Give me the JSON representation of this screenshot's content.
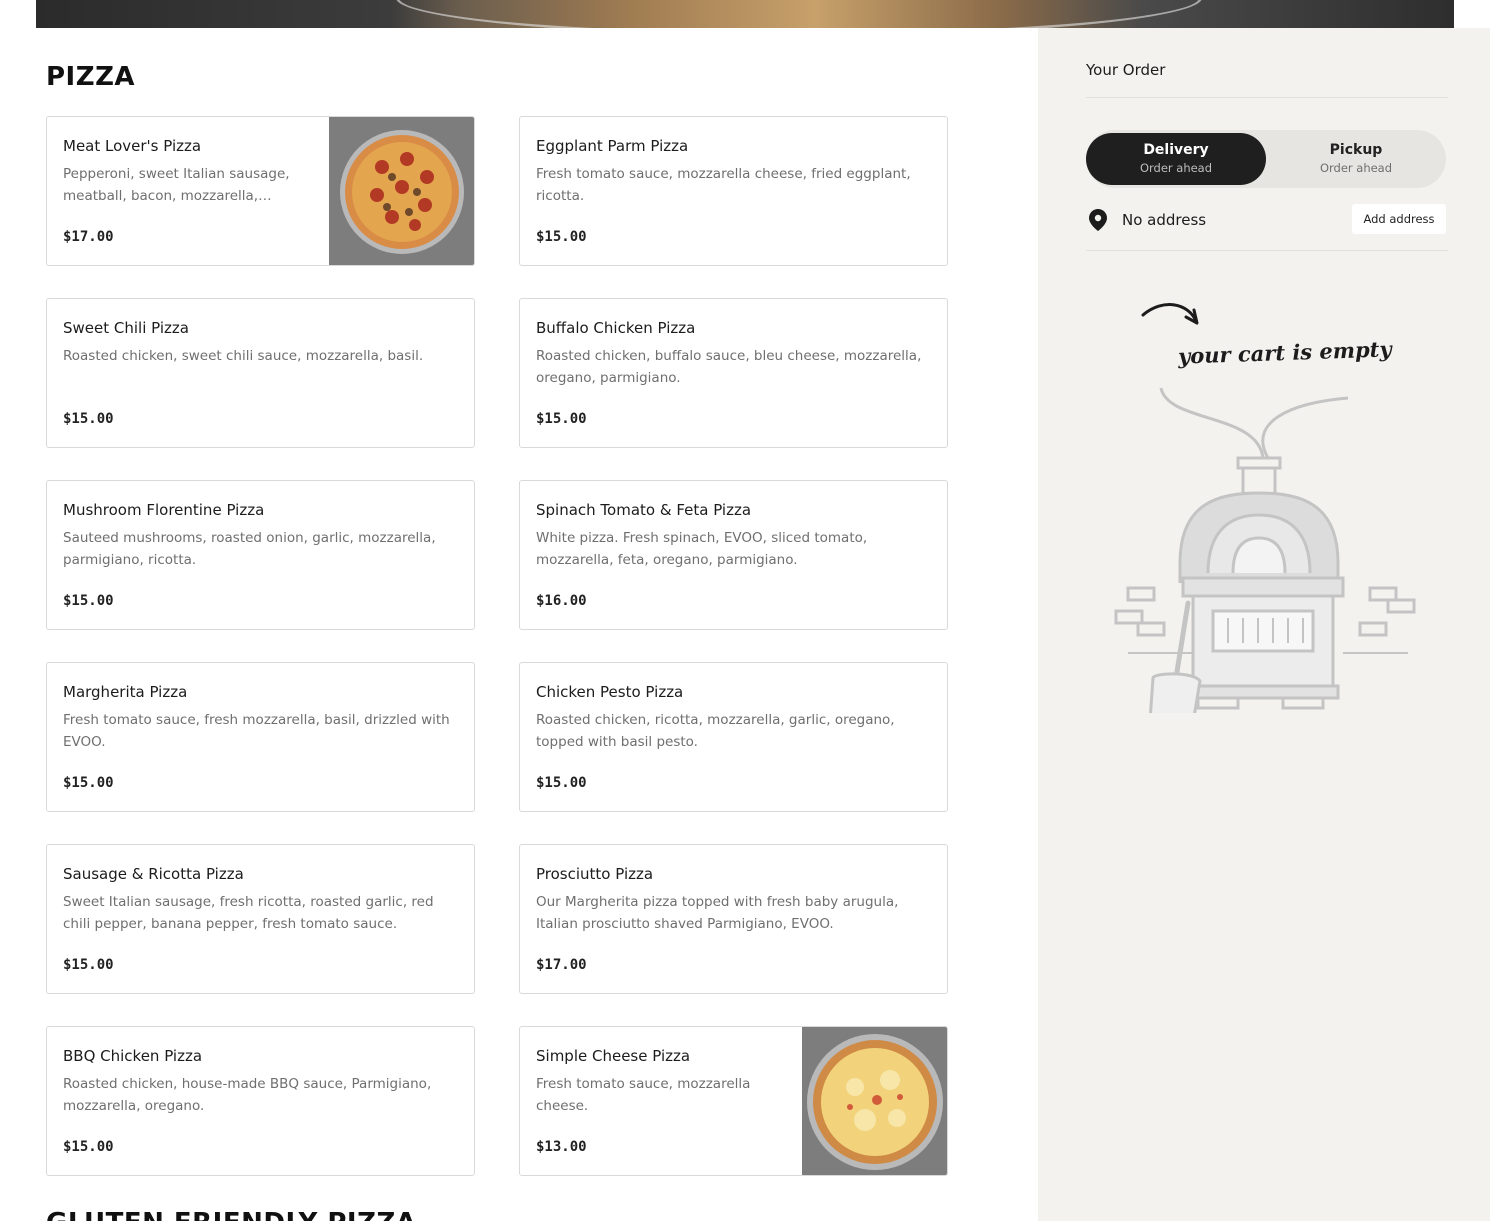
{
  "menu": {
    "section_title": "PIZZA",
    "next_section_title": "GLUTEN FRIENDLY PIZZA",
    "items": [
      {
        "name": "Meat Lover's Pizza",
        "description": "Pepperoni, sweet Italian sausage, meatball, bacon, mozzarella, tomato...",
        "price": "$17.00",
        "has_image": true
      },
      {
        "name": "Eggplant Parm Pizza",
        "description": "Fresh tomato sauce, mozzarella cheese, fried eggplant, ricotta.",
        "price": "$15.00",
        "has_image": false
      },
      {
        "name": "Sweet Chili Pizza",
        "description": "Roasted chicken, sweet chili sauce, mozzarella, basil.",
        "price": "$15.00",
        "has_image": false
      },
      {
        "name": "Buffalo Chicken Pizza",
        "description": "Roasted chicken, buffalo sauce, bleu cheese, mozzarella, oregano, parmigiano.",
        "price": "$15.00",
        "has_image": false
      },
      {
        "name": "Mushroom Florentine Pizza",
        "description": "Sauteed mushrooms, roasted onion, garlic, mozzarella, parmigiano, ricotta.",
        "price": "$15.00",
        "has_image": false
      },
      {
        "name": "Spinach Tomato & Feta Pizza",
        "description": "White pizza. Fresh spinach, EVOO, sliced tomato, mozzarella, feta, oregano, parmigiano.",
        "price": "$16.00",
        "has_image": false
      },
      {
        "name": "Margherita Pizza",
        "description": "Fresh tomato sauce, fresh mozzarella, basil, drizzled with EVOO.",
        "price": "$15.00",
        "has_image": false
      },
      {
        "name": "Chicken Pesto Pizza",
        "description": "Roasted chicken, ricotta, mozzarella, garlic, oregano, topped with basil pesto.",
        "price": "$15.00",
        "has_image": false
      },
      {
        "name": "Sausage & Ricotta Pizza",
        "description": "Sweet Italian sausage, fresh ricotta, roasted garlic, red chili pepper, banana pepper, fresh tomato sauce.",
        "price": "$15.00",
        "has_image": false
      },
      {
        "name": "Prosciutto Pizza",
        "description": "Our Margherita pizza topped with fresh baby arugula, Italian prosciutto shaved Parmigiano, EVOO.",
        "price": "$17.00",
        "has_image": false
      },
      {
        "name": "BBQ Chicken Pizza",
        "description": "Roasted chicken, house-made BBQ sauce, Parmigiano, mozzarella, oregano.",
        "price": "$15.00",
        "has_image": false
      },
      {
        "name": "Simple Cheese Pizza",
        "description": "Fresh tomato sauce, mozzarella cheese.",
        "price": "$13.00",
        "has_image": true
      }
    ]
  },
  "order": {
    "title": "Your Order",
    "delivery_label": "Delivery",
    "delivery_sub": "Order ahead",
    "pickup_label": "Pickup",
    "pickup_sub": "Order ahead",
    "address_text": "No address",
    "add_address_label": "Add address",
    "empty_cart_text": "your cart is empty"
  },
  "colors": {
    "accent_dark": "#1f1f1f",
    "sidebar_bg": "#f3f2ef",
    "card_border": "#d9d9d9"
  }
}
